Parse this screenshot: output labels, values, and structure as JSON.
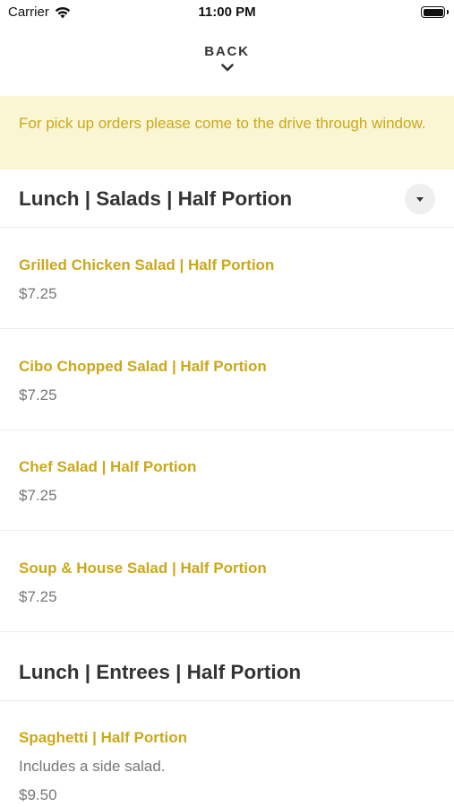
{
  "status_bar": {
    "carrier": "Carrier",
    "time": "11:00 PM"
  },
  "nav": {
    "back_label": "BACK"
  },
  "notice": {
    "text": "For pick up orders please come to the drive through window."
  },
  "sections": [
    {
      "title": "Lunch | Salads | Half Portion",
      "items": [
        {
          "name": "Grilled Chicken Salad | Half Portion",
          "price": "$7.25"
        },
        {
          "name": "Cibo Chopped Salad | Half Portion",
          "price": "$7.25"
        },
        {
          "name": "Chef Salad | Half Portion",
          "price": "$7.25"
        },
        {
          "name": "Soup & House Salad | Half Portion",
          "price": "$7.25"
        }
      ]
    },
    {
      "title": "Lunch | Entrees | Half Portion",
      "items": [
        {
          "name": "Spaghetti | Half Portion",
          "description": "Includes a side salad.",
          "price": "$9.50"
        }
      ]
    }
  ],
  "colors": {
    "accent": "#cba81a",
    "notice_bg": "#faf6d4",
    "text": "#333333",
    "muted": "#777777"
  },
  "icons": {
    "wifi": "wifi-icon",
    "battery": "battery-icon",
    "back": "chevron-down-icon",
    "expand": "triangle-down-icon"
  }
}
